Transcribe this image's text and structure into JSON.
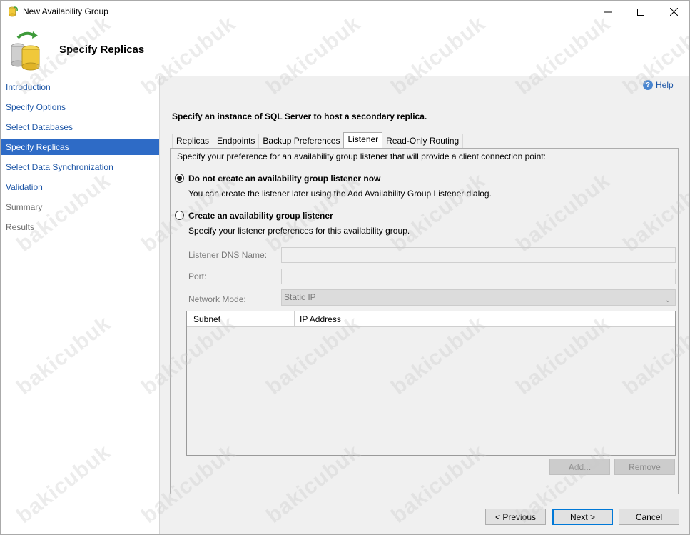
{
  "window": {
    "title": "New Availability Group"
  },
  "header": {
    "title": "Specify Replicas"
  },
  "nav": {
    "items": [
      {
        "label": "Introduction",
        "state": "link"
      },
      {
        "label": "Specify Options",
        "state": "link"
      },
      {
        "label": "Select Databases",
        "state": "link"
      },
      {
        "label": "Specify Replicas",
        "state": "active"
      },
      {
        "label": "Select Data Synchronization",
        "state": "link"
      },
      {
        "label": "Validation",
        "state": "link"
      },
      {
        "label": "Summary",
        "state": "disabled"
      },
      {
        "label": "Results",
        "state": "disabled"
      }
    ]
  },
  "help": {
    "label": "Help"
  },
  "main": {
    "instruction": "Specify an instance of SQL Server to host a secondary replica.",
    "tabs": [
      {
        "label": "Replicas",
        "active": false
      },
      {
        "label": "Endpoints",
        "active": false
      },
      {
        "label": "Backup Preferences",
        "active": false
      },
      {
        "label": "Listener",
        "active": true
      },
      {
        "label": "Read-Only Routing",
        "active": false
      }
    ],
    "listener": {
      "intro": "Specify your preference for an availability group listener that will provide a client connection point:",
      "option_none": {
        "label": "Do not create an availability group listener now",
        "description": "You can create the listener later using the Add Availability Group Listener dialog.",
        "checked": true
      },
      "option_create": {
        "label": "Create an availability group listener",
        "description": "Specify your listener preferences for this availability group.",
        "checked": false
      },
      "dns_name_label": "Listener DNS Name:",
      "dns_name_value": "",
      "port_label": "Port:",
      "port_value": "",
      "network_mode_label": "Network Mode:",
      "network_mode_value": "Static IP",
      "grid_columns": [
        "Subnet",
        "IP Address"
      ],
      "add_button": "Add...",
      "remove_button": "Remove"
    }
  },
  "footer": {
    "previous": "< Previous",
    "next": "Next >",
    "cancel": "Cancel"
  },
  "watermark": "bakicubuk",
  "colors": {
    "nav_link": "#1c55a6",
    "nav_active_bg": "#2e6bc6",
    "default_button_border": "#0078d7"
  }
}
